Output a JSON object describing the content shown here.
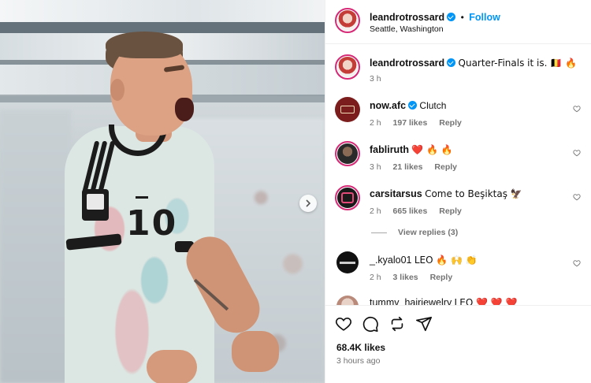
{
  "post": {
    "username": "leandrotrossard",
    "follow_label": "Follow",
    "location": "Seattle, Washington",
    "caption_user": "leandrotrossard",
    "caption_text": "Quarter-Finals it is. 🇧🇪 🔥",
    "caption_time": "3 h"
  },
  "comments": [
    {
      "user": "now.afc",
      "verified": true,
      "text": "Clutch",
      "time": "2 h",
      "likes": "197 likes",
      "reply": "Reply"
    },
    {
      "user": "fabliruth",
      "verified": false,
      "text": "❤️ 🔥 🔥",
      "time": "3 h",
      "likes": "21 likes",
      "reply": "Reply"
    },
    {
      "user": "carsitarsus",
      "verified": false,
      "text": "Come to Beşiktaş 🦅",
      "time": "2 h",
      "likes": "665 likes",
      "reply": "Reply"
    },
    {
      "user": "_.kyalo01",
      "verified": false,
      "text": "LEO 🔥 🙌 👏",
      "time": "2 h",
      "likes": "3 likes",
      "reply": "Reply"
    },
    {
      "user": "tummy_hairjewelry",
      "verified": false,
      "text": "LEO ❤️ ❤️ ❤️",
      "time": "",
      "likes": "",
      "reply": ""
    }
  ],
  "view_replies": "View replies (3)",
  "actions": {
    "likes": "68.4K likes",
    "ago": "3 hours ago"
  },
  "icons": {
    "next": "chevron-right-icon",
    "like": "heart-icon",
    "comment": "comment-icon",
    "share": "repost-icon",
    "send": "send-icon",
    "verified": "verified-badge-icon"
  },
  "photo": {
    "jersey_number": "10"
  },
  "colors": {
    "link_blue": "#0095f6",
    "muted_text": "#737373",
    "story_ring": "#d62976"
  }
}
